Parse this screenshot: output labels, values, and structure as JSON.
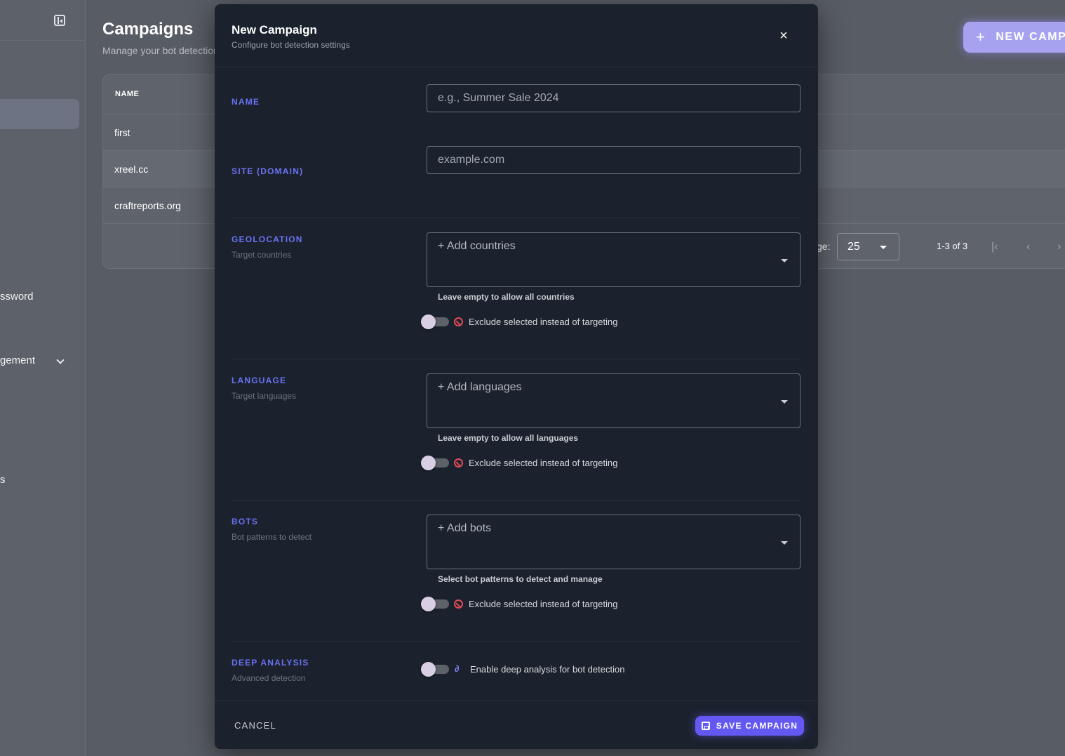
{
  "background": {
    "sidebar": {
      "items": [
        "ssword",
        "gement",
        "s"
      ]
    },
    "page_title": "Campaigns",
    "page_subtitle": "Manage your bot detection",
    "new_campaign_label": "NEW CAMP",
    "table": {
      "header_name": "NAME",
      "rows": [
        "first",
        "xreel.cc",
        "craftreports.org"
      ]
    },
    "pager": {
      "label": "ge:",
      "per_page": "25",
      "range": "1-3 of 3",
      "first": "|‹",
      "prev": "‹",
      "next": "›"
    }
  },
  "modal": {
    "title": "New Campaign",
    "subtitle": "Configure bot detection settings",
    "close": "×",
    "name": {
      "label": "NAME",
      "placeholder": "e.g., Summer Sale 2024"
    },
    "site": {
      "label": "SITE (DOMAIN)",
      "placeholder": "example.com"
    },
    "geolocation": {
      "label": "GEOLOCATION",
      "desc": "Target countries",
      "placeholder": "+ Add countries",
      "helper": "Leave empty to allow all countries",
      "toggle": "Exclude selected instead of targeting"
    },
    "language": {
      "label": "LANGUAGE",
      "desc": "Target languages",
      "placeholder": "+ Add languages",
      "helper": "Leave empty to allow all languages",
      "toggle": "Exclude selected instead of targeting"
    },
    "bots": {
      "label": "BOTS",
      "desc": "Bot patterns to detect",
      "placeholder": "+ Add bots",
      "helper": "Select bot patterns to detect and manage",
      "toggle": "Exclude selected instead of targeting"
    },
    "deep_analysis": {
      "label": "DEEP ANALYSIS",
      "desc": "Advanced detection",
      "toggle": "Enable deep analysis for bot detection"
    },
    "footer": {
      "cancel": "CANCEL",
      "save": "SAVE CAMPAIGN"
    }
  },
  "colors": {
    "accent": "#6458f2",
    "section_label": "#6a72f4",
    "modal_bg": "#1b222d",
    "ban": "#e24b55"
  },
  "icons": [
    "sidebar-collapse-icon",
    "plus-icon",
    "close-icon",
    "chevron-down-icon",
    "ban-icon",
    "flask-icon",
    "save-icon"
  ]
}
